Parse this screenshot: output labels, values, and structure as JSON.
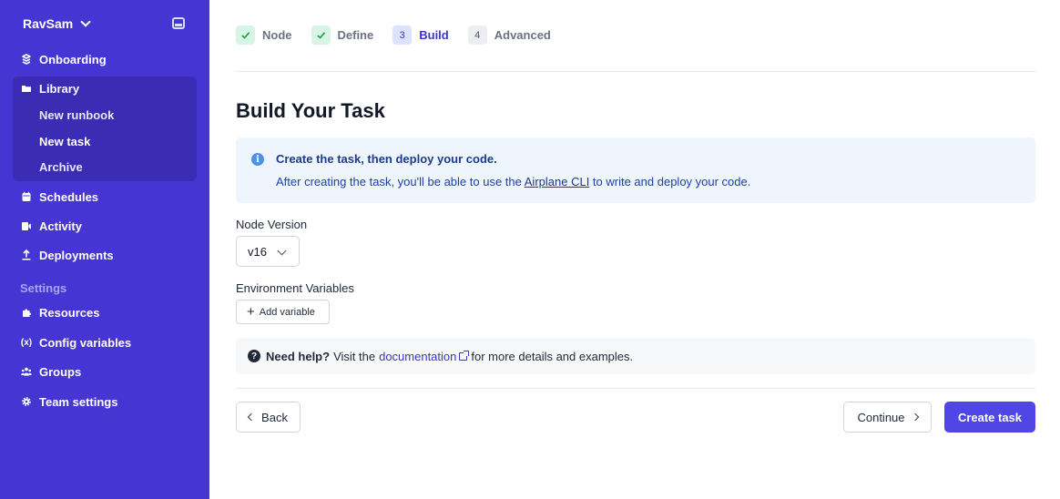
{
  "sidebar": {
    "org_name": "RavSam",
    "nav": [
      {
        "label": "Onboarding",
        "icon": "onboarding-icon"
      },
      {
        "label": "Library",
        "icon": "folder-icon"
      },
      {
        "label": "Schedules",
        "icon": "calendar-icon"
      },
      {
        "label": "Activity",
        "icon": "activity-icon"
      },
      {
        "label": "Deployments",
        "icon": "upload-icon"
      }
    ],
    "library_items": [
      "New runbook",
      "New task",
      "Archive"
    ],
    "settings_label": "Settings",
    "settings_nav": [
      {
        "label": "Resources",
        "icon": "puzzle-icon"
      },
      {
        "label": "Config variables",
        "icon": "variable-icon"
      },
      {
        "label": "Groups",
        "icon": "users-icon"
      },
      {
        "label": "Team settings",
        "icon": "gear-icon"
      }
    ]
  },
  "steps": [
    {
      "number": "",
      "label": "Node",
      "state": "done"
    },
    {
      "number": "",
      "label": "Define",
      "state": "done"
    },
    {
      "number": "3",
      "label": "Build",
      "state": "current"
    },
    {
      "number": "4",
      "label": "Advanced",
      "state": "future"
    }
  ],
  "page_title": "Build Your Task",
  "alert": {
    "title": "Create the task, then deploy your code.",
    "body_before": "After creating the task, you'll be able to use the ",
    "link": "Airplane CLI",
    "body_after": " to write and deploy your code."
  },
  "node_version": {
    "label": "Node Version",
    "value": "v16"
  },
  "env_vars": {
    "label": "Environment Variables",
    "add_button": "Add variable"
  },
  "help": {
    "bold": "Need help?",
    "before": "Visit the",
    "link": "documentation",
    "after": "for more details and examples."
  },
  "buttons": {
    "back": "Back",
    "continue": "Continue",
    "create": "Create task"
  },
  "colors": {
    "sidebar": "#4536d4",
    "primary": "#4f46e5",
    "alert_bg": "#eef5fd"
  }
}
